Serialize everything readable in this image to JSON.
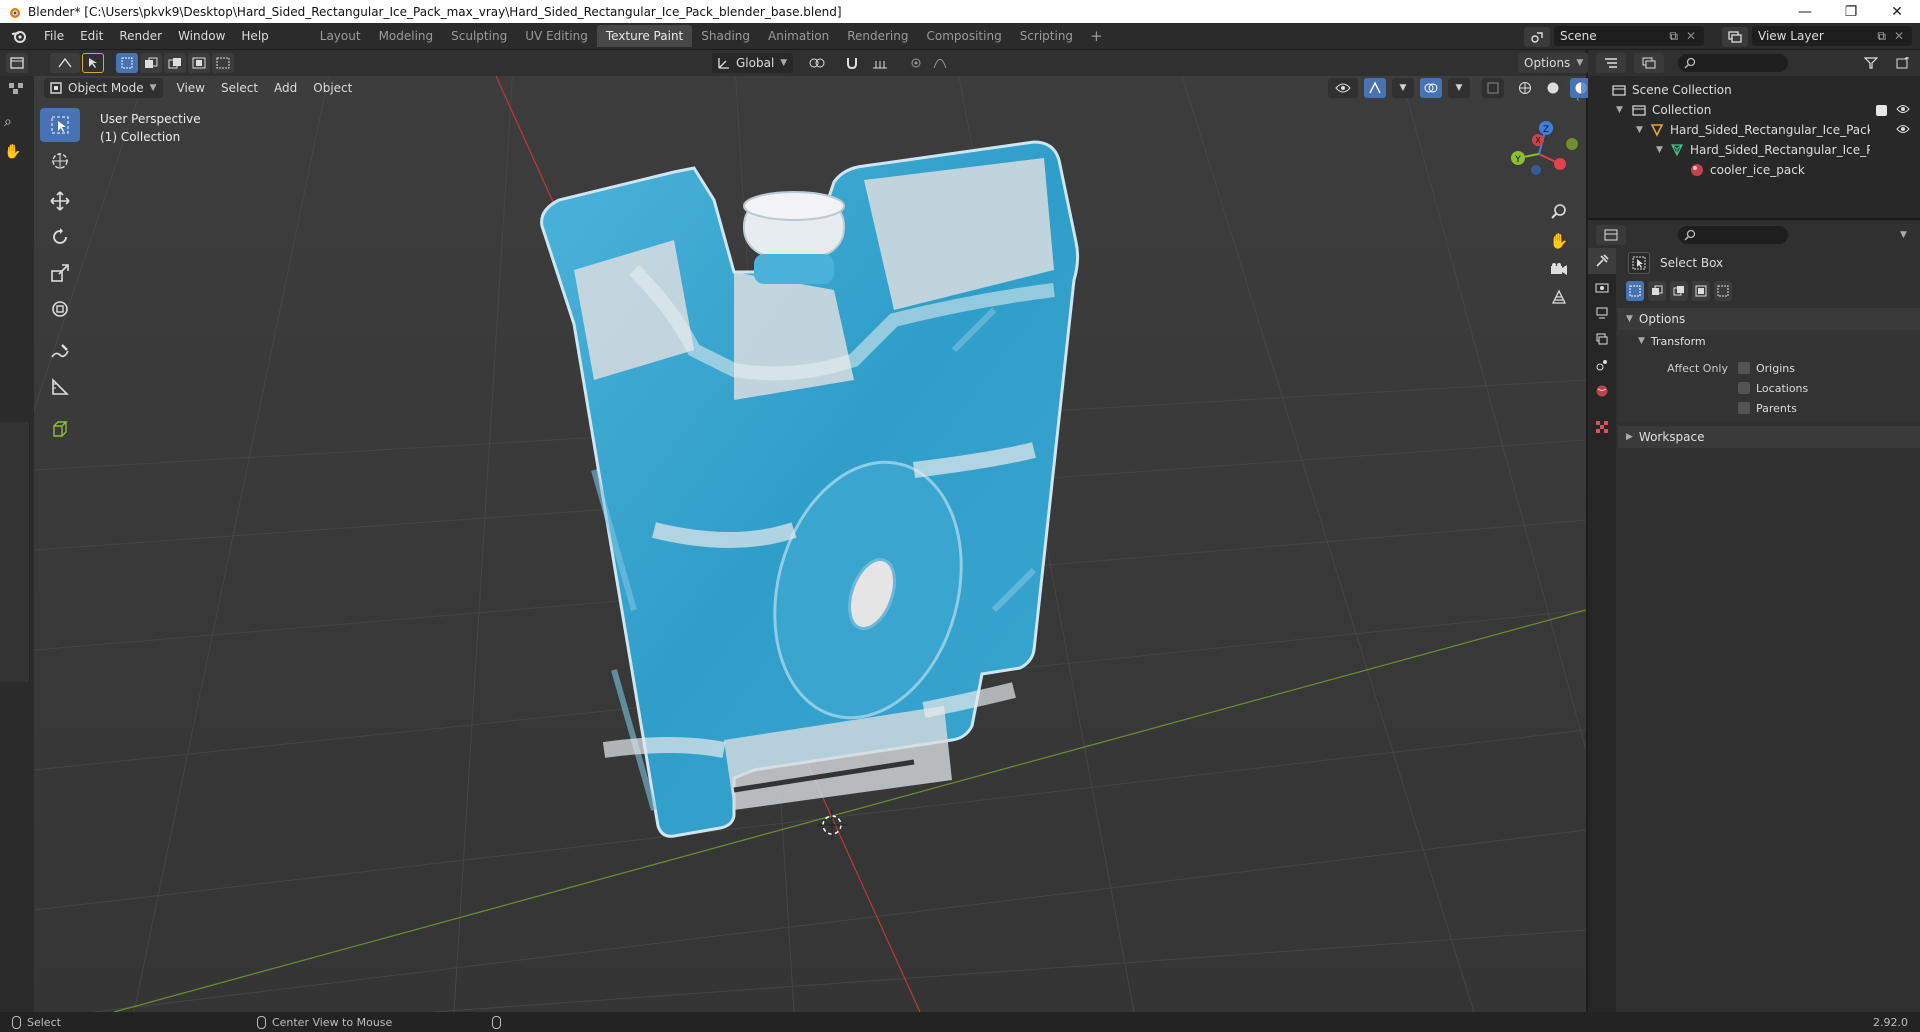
{
  "window": {
    "title": "Blender* [C:\\Users\\pkvk9\\Desktop\\Hard_Sided_Rectangular_Ice_Pack_max_vray\\Hard_Sided_Rectangular_Ice_Pack_blender_base.blend]",
    "minimize": "—",
    "maximize": "❐",
    "close": "✕"
  },
  "menu": [
    "File",
    "Edit",
    "Render",
    "Window",
    "Help"
  ],
  "workspaces": [
    "Layout",
    "Modeling",
    "Sculpting",
    "UV Editing",
    "Texture Paint",
    "Shading",
    "Animation",
    "Rendering",
    "Compositing",
    "Scripting"
  ],
  "active_workspace": "Texture Paint",
  "workspace_add": "+",
  "scene": {
    "label": "Scene",
    "view_layer": "View Layer"
  },
  "viewport_header": {
    "orientation": "Global",
    "options": "Options",
    "mode": "Object Mode",
    "menus": [
      "View",
      "Select",
      "Add",
      "Object"
    ]
  },
  "viewport": {
    "perspective": "User Perspective",
    "collection": "(1) Collection",
    "gizmo_axes": {
      "x": "X",
      "y": "Y",
      "z": "Z"
    }
  },
  "outliner": {
    "scene_collection": "Scene Collection",
    "collection": "Collection",
    "object": "Hard_Sided_Rectangular_Ice_Pack_obj_t",
    "mesh": "Hard_Sided_Rectangular_Ice_Pack_c",
    "material": "cooler_ice_pack"
  },
  "properties": {
    "tool_name": "Select Box",
    "options": "Options",
    "transform": "Transform",
    "affect_only": "Affect Only",
    "origins": "Origins",
    "locations": "Locations",
    "parents": "Parents",
    "workspace": "Workspace"
  },
  "status": {
    "select": "Select",
    "center_view": "Center View to Mouse",
    "version": "2.92.0"
  },
  "colors": {
    "accent": "#4772b3",
    "ice_blue": "#3ca9d2",
    "x_axis": "#e0424f",
    "y_axis": "#8bbf2c",
    "z_axis": "#3f7fdc"
  }
}
